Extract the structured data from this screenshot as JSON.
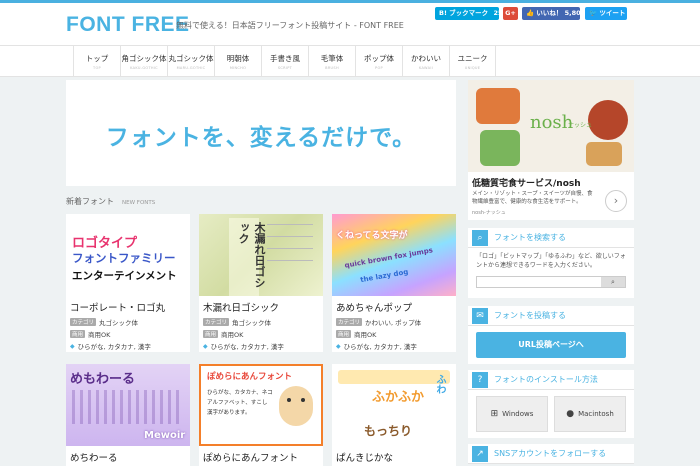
{
  "header": {
    "logo": "FONT FREE",
    "tagline": "無料で使える！日本語フリーフォント投稿サイト - FONT FREE",
    "hatena": "B! ブックマーク",
    "hatena_count": "25",
    "gplus": "G+",
    "fb_like": "いいね！",
    "fb_count": "5,804",
    "tweet": "ツイート"
  },
  "nav": [
    {
      "jp": "トップ",
      "en": "TOP"
    },
    {
      "jp": "角ゴシック体",
      "en": "KAKU-GOTHIC"
    },
    {
      "jp": "丸ゴシック体",
      "en": "MARU-GOTHIC"
    },
    {
      "jp": "明朝体",
      "en": "MINCHO"
    },
    {
      "jp": "手書き風",
      "en": "SCRIPT"
    },
    {
      "jp": "毛筆体",
      "en": "BRUSH"
    },
    {
      "jp": "ポップ体",
      "en": "POP"
    },
    {
      "jp": "かわいい",
      "en": "KAWAII"
    },
    {
      "jp": "ユニーク",
      "en": "UNIQUE"
    }
  ],
  "hero": {
    "text": "フォントを、変えるだけで。"
  },
  "section": {
    "title": "新着フォント",
    "en": "NEW FONTS"
  },
  "labels": {
    "category": "カテゴリ",
    "license": "商用",
    "tag_icon": "◆"
  },
  "cards": [
    {
      "title": "コーポレート・ロゴ丸",
      "category": "丸ゴシック体",
      "license": "商用OK",
      "tags": "ひらがな, カタカナ, 漢字",
      "preview": [
        "ロゴタイプ",
        "フォントファミリー",
        "エンターテインメント"
      ]
    },
    {
      "title": "木漏れ日ゴシック",
      "category": "角ゴシック体",
      "license": "商用OK",
      "tags": "ひらがな, カタカナ, 漢字",
      "preview": [
        "木漏れ日ゴシック"
      ]
    },
    {
      "title": "あめちゃんポップ",
      "category": "かわいい, ポップ体",
      "license": "商用OK",
      "tags": "ひらがな, カタカナ, 漢字",
      "preview": [
        "くねってる文字が",
        "quick brown fox jumps",
        "the lazy dog"
      ]
    },
    {
      "title": "めちわーる",
      "preview": [
        "めもわーる",
        "Mewoir"
      ]
    },
    {
      "title": "ぽめらにあんフォント",
      "preview": [
        "ぽめらにあんフォント",
        "ひらがな、カタカナ、ネコ",
        "アルファベット、すこし",
        "漢字があります。"
      ]
    },
    {
      "title": "ぱんきじかな",
      "preview": [
        "ふかふか",
        "ふわ",
        "もっちり"
      ]
    }
  ],
  "ad": {
    "brand": "nosh",
    "brand_sub": "ナッシュ",
    "title": "低糖質宅食サービス/nosh",
    "text": "メイン・リゾット・スープ・スイーツが自慢、食物繊維豊富で、健康的な食生活をサポート。",
    "source": "nosh-ナッシュ",
    "arrow": "›"
  },
  "widgets": {
    "search": {
      "title": "フォントを検索する",
      "text": "「ロゴ」「ビットマップ」「ゆるふわ」など、欲しいフォントから連想できるワードを入力ください。",
      "button": "検索"
    },
    "post": {
      "title": "フォントを投稿する",
      "button": "URL投稿ページへ"
    },
    "install": {
      "title": "フォントのインストール方法",
      "windows": "Windows",
      "mac": "Macintosh"
    },
    "sns": {
      "title": "SNSアカウントをフォローする"
    }
  },
  "colors": {
    "accent": "#4ab3e2",
    "hatena": "#00a4de",
    "gplus": "#dd4b39",
    "facebook": "#4267b2",
    "twitter": "#1da1f2"
  }
}
